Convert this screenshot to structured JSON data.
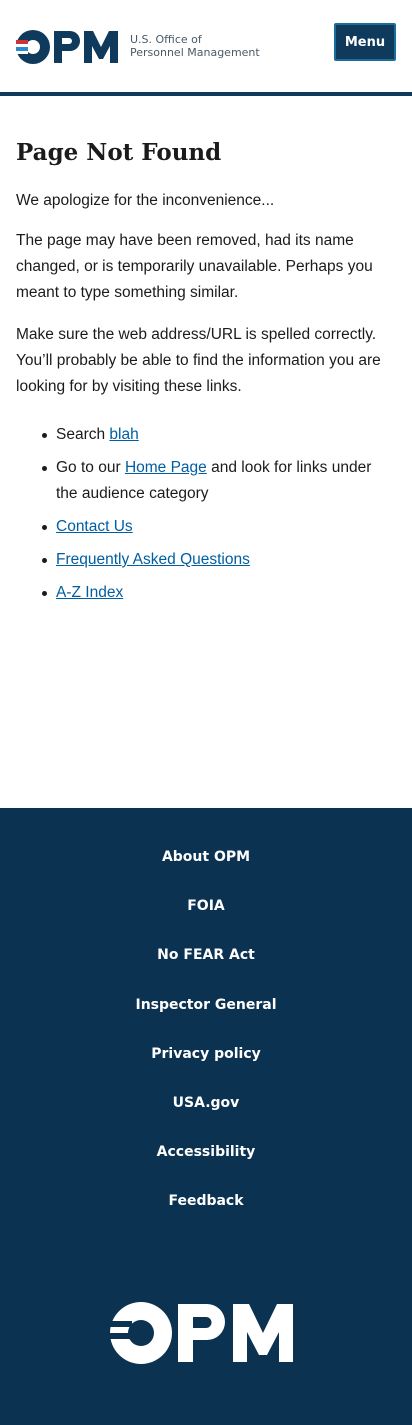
{
  "header": {
    "logo_text": "OPM",
    "logo_subtitle_line1": "U.S. Office of",
    "logo_subtitle_line2": "Personnel Management",
    "menu_label": "Menu"
  },
  "main": {
    "title": "Page Not Found",
    "intro": "We apologize for the inconvenience...",
    "para1": "The page may have been removed, had its name changed, or is temporarily unavailable. Perhaps you meant to type something similar.",
    "para2": "Make sure the web address/URL is spelled correctly. You’ll probably be able to find the information you are looking for by visiting these links.",
    "links": {
      "search_prefix": "Search ",
      "search_link": "blah",
      "home_prefix": "Go to our ",
      "home_link": "Home Page",
      "home_suffix": " and look for links under the audience category",
      "contact": "Contact Us",
      "faq": "Frequently Asked Questions",
      "az": "A-Z Index"
    }
  },
  "footer": {
    "links": [
      "About OPM",
      "FOIA",
      "No FEAR Act",
      "Inspector General",
      "Privacy policy",
      "USA.gov",
      "Accessibility",
      "Feedback"
    ],
    "logo_text": "OPM"
  },
  "colors": {
    "brand_navy": "#0f3a5c",
    "footer_navy": "#0c3252",
    "link_blue": "#005ea2",
    "accent_red": "#c9353b",
    "accent_blue": "#2b8ac9"
  },
  "icons": {
    "logo": "opm-logo-icon",
    "bullet": "bullet-dot-icon"
  }
}
